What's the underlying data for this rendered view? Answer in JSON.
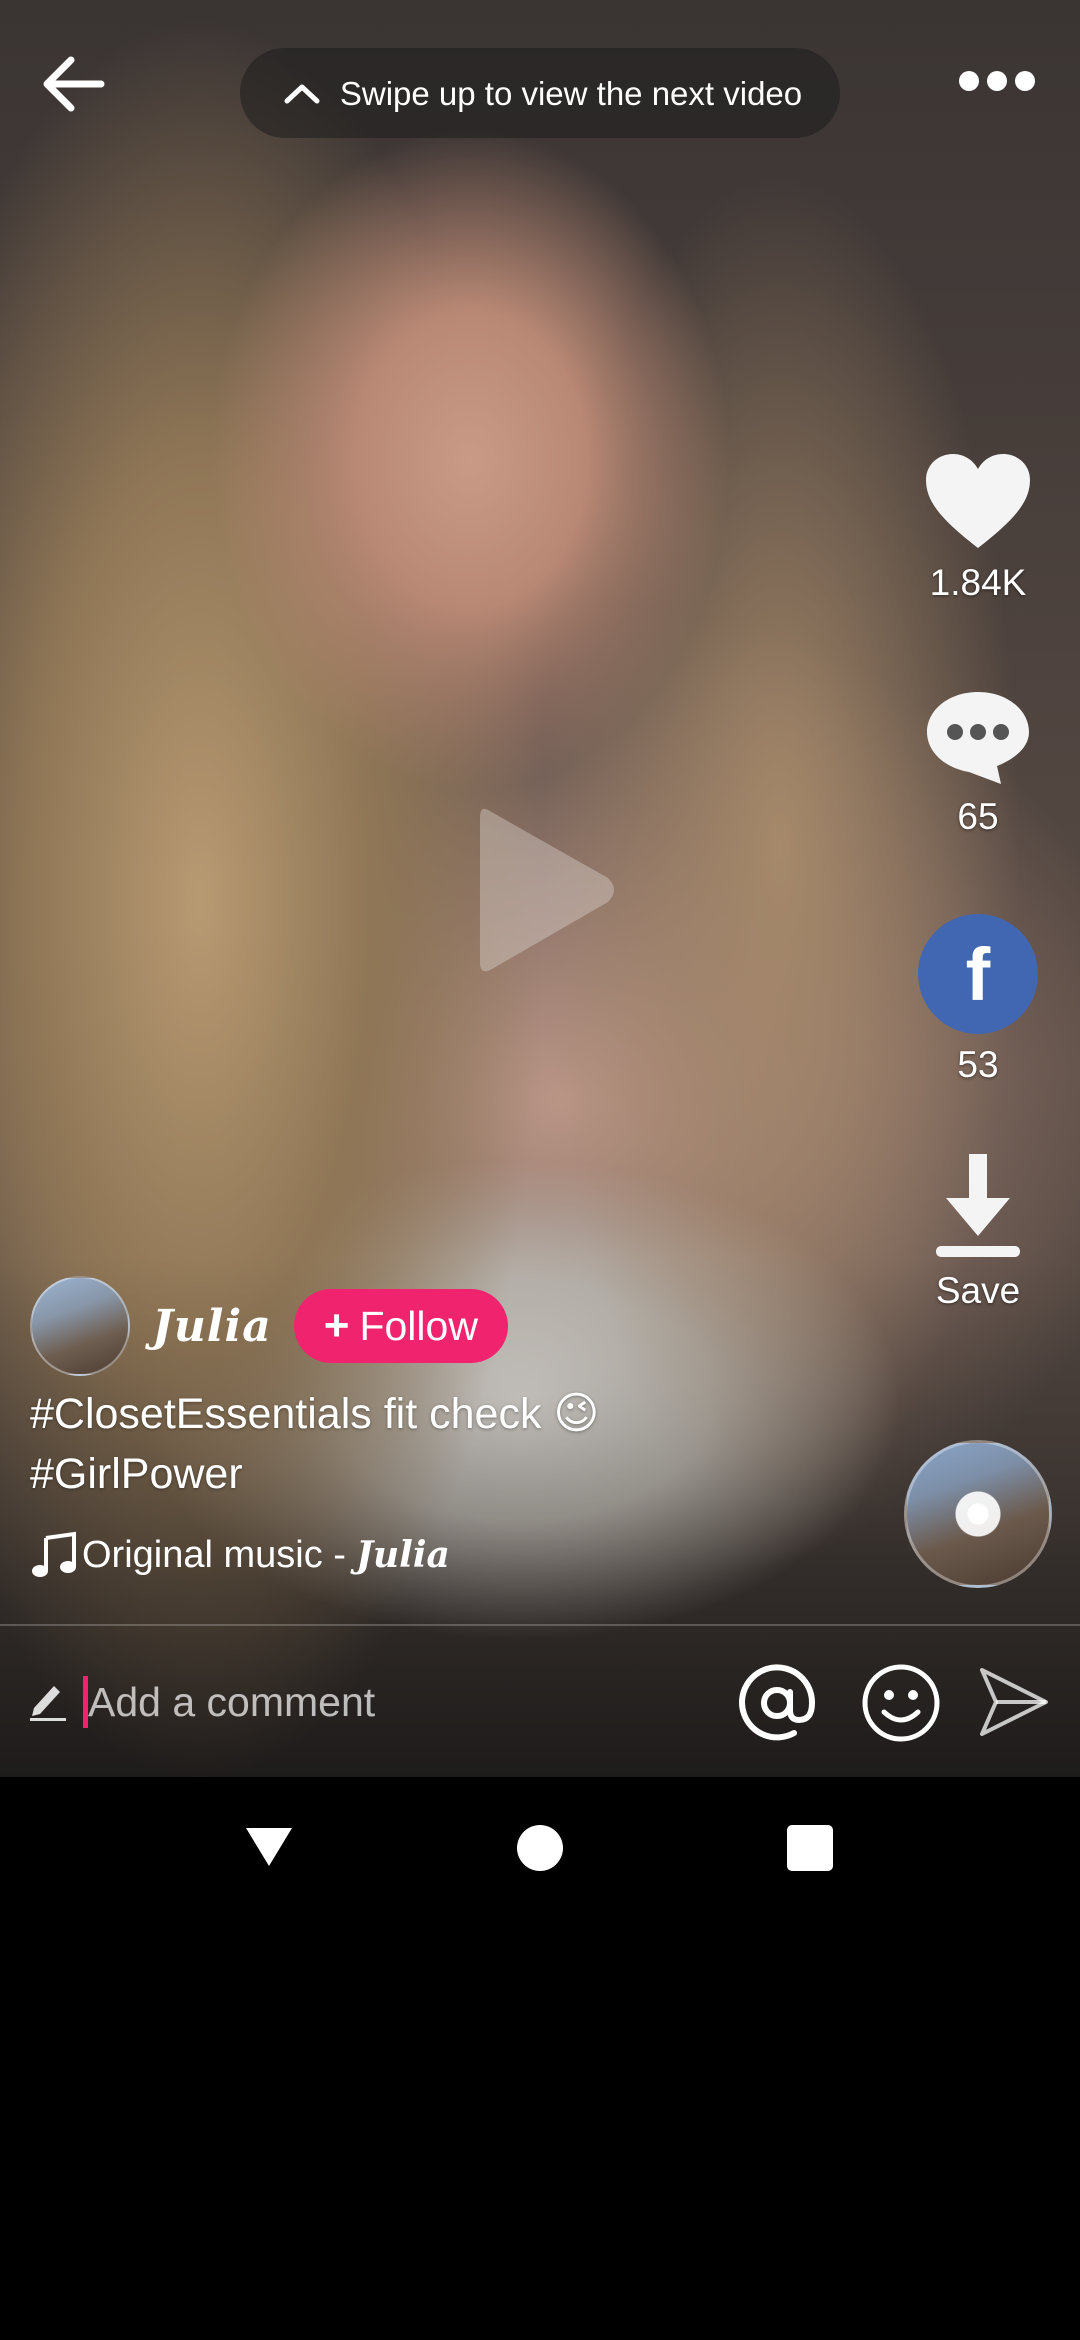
{
  "top_bar": {
    "swipe_hint": "Swipe up to view the next video"
  },
  "actions": {
    "likes": "1.84K",
    "comments": "65",
    "shares": "53",
    "save_label": "Save",
    "share_platform_letter": "f"
  },
  "author": {
    "name": "Julia",
    "follow_label": "Follow",
    "follow_plus": "+"
  },
  "caption": {
    "line1": "#ClosetEssentials  fit check",
    "emoji": "😉",
    "line2": "#GirlPower"
  },
  "music": {
    "title": "Original music - ",
    "author": "Julia"
  },
  "comment_bar": {
    "placeholder": "Add a comment"
  },
  "colors": {
    "follow_button": "#f0246e",
    "facebook_blue": "#4267b2",
    "caret": "#f0246e"
  },
  "icons": {
    "back": "arrow-left-icon",
    "swipe": "chevron-up-icon",
    "more": "more-horizontal-icon",
    "play": "play-icon",
    "like": "heart-icon",
    "comment": "comment-bubble-icon",
    "share": "facebook-icon",
    "save": "download-icon",
    "music": "music-note-icon",
    "edit": "pencil-icon",
    "mention": "at-sign-icon",
    "emoji": "smiley-icon",
    "send": "send-icon"
  }
}
